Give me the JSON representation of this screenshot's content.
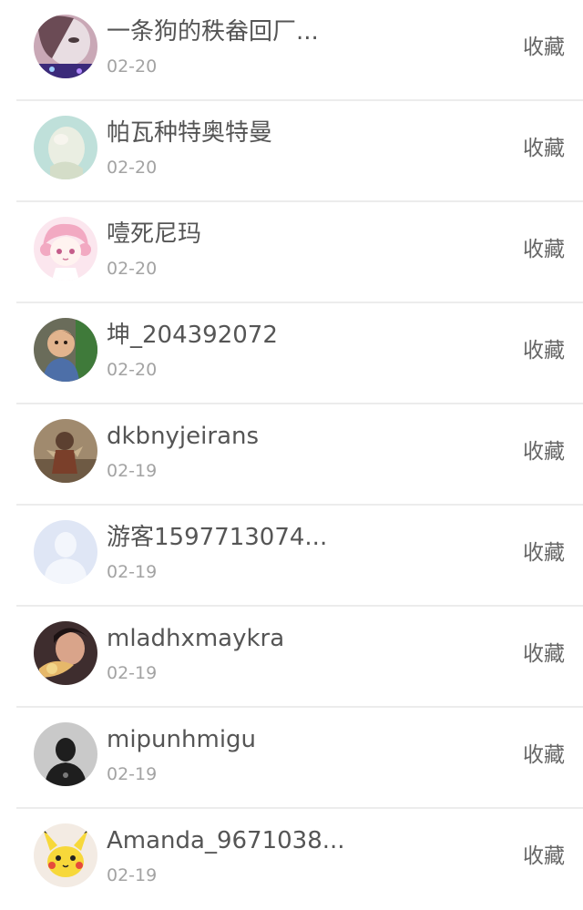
{
  "users": [
    {
      "name": "一条狗的秩畚回厂...",
      "date": "02-20",
      "action": "收藏",
      "avatar_icon": "avatar-girl-photo-icon",
      "avatar_bg": "#c9a8b6"
    },
    {
      "name": "帕瓦种特奥特曼",
      "date": "02-20",
      "action": "收藏",
      "avatar_icon": "avatar-teal-photo-icon",
      "avatar_bg": "#bfe0da"
    },
    {
      "name": "噎死尼玛",
      "date": "02-20",
      "action": "收藏",
      "avatar_icon": "avatar-anime-girl-icon",
      "avatar_bg": "#fbe6ee"
    },
    {
      "name": "坤_204392072",
      "date": "02-20",
      "action": "收藏",
      "avatar_icon": "avatar-child-photo-icon",
      "avatar_bg": "#6a6c5a"
    },
    {
      "name": "dkbnyjeirans",
      "date": "02-19",
      "action": "收藏",
      "avatar_icon": "avatar-sepia-photo-icon",
      "avatar_bg": "#a08a6e"
    },
    {
      "name": "游客1597713074...",
      "date": "02-19",
      "action": "收藏",
      "avatar_icon": "avatar-default-user-icon",
      "avatar_bg": "#dfe6f5"
    },
    {
      "name": "mladhxmaykra",
      "date": "02-19",
      "action": "收藏",
      "avatar_icon": "avatar-dark-photo-icon",
      "avatar_bg": "#3e2d2e"
    },
    {
      "name": "mipunhmigu",
      "date": "02-19",
      "action": "收藏",
      "avatar_icon": "avatar-silhouette-icon",
      "avatar_bg": "#c9c9c9"
    },
    {
      "name": "Amanda_9671038...",
      "date": "02-19",
      "action": "收藏",
      "avatar_icon": "avatar-pikachu-icon",
      "avatar_bg": "#f3ebe3"
    }
  ]
}
